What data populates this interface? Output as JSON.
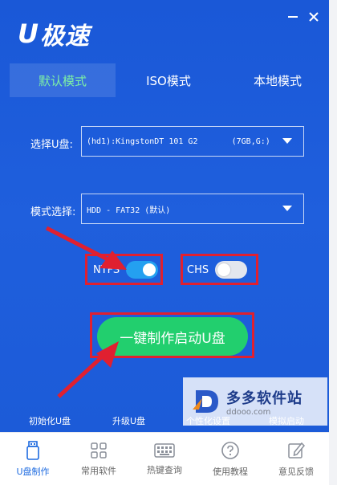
{
  "app": {
    "logo_u": "U",
    "logo_text": "极速"
  },
  "tabs": [
    {
      "label": "默认模式",
      "active": true
    },
    {
      "label": "ISO模式",
      "active": false
    },
    {
      "label": "本地模式",
      "active": false
    }
  ],
  "form": {
    "usb_label": "选择U盘:",
    "usb_value": "(hd1):KingstonDT 101 G2       (7GB,G:)",
    "mode_label": "模式选择:",
    "mode_value": "HDD - FAT32 (默认)"
  },
  "toggles": {
    "ntfs_label": "NTFS",
    "ntfs_on": true,
    "chs_label": "CHS",
    "chs_on": false
  },
  "main_button": "一键制作启动U盘",
  "links": [
    "初始化U盘",
    "升级U盘",
    "个性化设置",
    "模拟启动"
  ],
  "watermark": {
    "title": "多多软件站",
    "url": "ddooo.com"
  },
  "nav": [
    {
      "label": "U盘制作",
      "icon": "usb-drive-icon",
      "active": true
    },
    {
      "label": "常用软件",
      "icon": "grid-apps-icon",
      "active": false
    },
    {
      "label": "热键查询",
      "icon": "keyboard-icon",
      "active": false
    },
    {
      "label": "使用教程",
      "icon": "help-circle-icon",
      "active": false
    },
    {
      "label": "意见反馈",
      "icon": "edit-feedback-icon",
      "active": false
    }
  ],
  "colors": {
    "primary_blue": "#1c5bd8",
    "accent_green": "#22cf6e",
    "active_tab_text": "#7ef0a4",
    "annotation_red": "#e02030",
    "nav_active": "#1e6be0"
  }
}
